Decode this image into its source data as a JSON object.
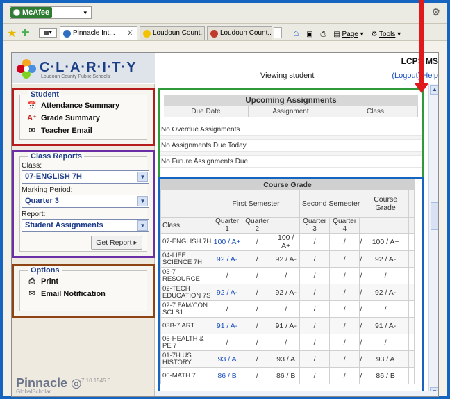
{
  "browser": {
    "toolbar_name": "McAfee",
    "tabs": [
      {
        "label": "Pinnacle Int...",
        "close": "X"
      },
      {
        "label": "Loudoun Count..."
      },
      {
        "label": "Loudoun Count..."
      }
    ],
    "tools": {
      "page": "Page",
      "tools": "Tools"
    }
  },
  "header": {
    "app_name": "C·L·A·R·I·T·Y",
    "subtitle": "Loudoun County Public Schools",
    "school": "LCPS MS",
    "viewing": "Viewing student",
    "logout": "Logout",
    "help": "Help"
  },
  "sidebar": {
    "student": {
      "title": "Student",
      "items": [
        "Attendance Summary",
        "Grade Summary",
        "Teacher Email"
      ]
    },
    "class_reports": {
      "title": "Class Reports",
      "class_label": "Class:",
      "class_value": "07-ENGLISH 7H",
      "period_label": "Marking Period:",
      "period_value": "Quarter 3",
      "report_label": "Report:",
      "report_value": "Student Assignments",
      "button": "Get Report"
    },
    "options": {
      "title": "Options",
      "items": [
        "Print",
        "Email Notification"
      ]
    },
    "footer": {
      "brand": "Pinnacle",
      "brand_sub": "GlobalScholar",
      "version": "v7.10.1545.0"
    }
  },
  "upcoming": {
    "title": "Upcoming Assignments",
    "columns": [
      "Due Date",
      "Assignment",
      "Class"
    ],
    "rows": [
      "No Overdue Assignments",
      "No Assignments Due Today",
      "No Future Assignments Due"
    ]
  },
  "course_grade": {
    "title": "Course Grade",
    "sem1": "First Semester",
    "sem2": "Second Semester",
    "final": "Course Grade",
    "class_header": "Class",
    "q1": "Quarter 1",
    "q2": "Quarter 2",
    "q3": "Quarter 3",
    "q4": "Quarter 4",
    "rows": [
      {
        "cls": "07-ENGLISH 7H",
        "q1": "100 / A+",
        "q2": "/",
        "s1": "100 / A+",
        "q3": "/",
        "q4": "/",
        "s2": "/",
        "fin": "100 / A+"
      },
      {
        "cls": "04-LIFE SCIENCE 7H",
        "q1": "92 / A-",
        "q2": "/",
        "s1": "92 / A-",
        "q3": "/",
        "q4": "/",
        "s2": "/",
        "fin": "92 / A-"
      },
      {
        "cls": "03-7 RESOURCE",
        "q1": "/",
        "q2": "/",
        "s1": "/",
        "q3": "/",
        "q4": "/",
        "s2": "/",
        "fin": "/"
      },
      {
        "cls": "02-TECH EDUCATION 7S",
        "q1": "92 / A-",
        "q2": "/",
        "s1": "92 / A-",
        "q3": "/",
        "q4": "/",
        "s2": "/",
        "fin": "92 / A-"
      },
      {
        "cls": "02-7 FAM/CON SCI S1",
        "q1": "/",
        "q2": "/",
        "s1": "/",
        "q3": "/",
        "q4": "/",
        "s2": "/",
        "fin": "/"
      },
      {
        "cls": "03B-7 ART",
        "q1": "91 / A-",
        "q2": "/",
        "s1": "91 / A-",
        "q3": "/",
        "q4": "/",
        "s2": "/",
        "fin": "91 / A-"
      },
      {
        "cls": "05-HEALTH & PE 7",
        "q1": "/",
        "q2": "/",
        "s1": "/",
        "q3": "/",
        "q4": "/",
        "s2": "/",
        "fin": "/"
      },
      {
        "cls": "01-7H US HISTORY",
        "q1": "93 / A",
        "q2": "/",
        "s1": "93 / A",
        "q3": "/",
        "q4": "/",
        "s2": "/",
        "fin": "93 / A"
      },
      {
        "cls": "06-MATH 7",
        "q1": "86 / B",
        "q2": "/",
        "s1": "86 / B",
        "q3": "/",
        "q4": "/",
        "s2": "/",
        "fin": "86 / B"
      }
    ]
  },
  "colors": {
    "accent": "#1f3d8b",
    "link": "#1a4fbf",
    "annot_red": "#b71c1c",
    "annot_purple": "#6a2fa6",
    "annot_brown": "#8d4313",
    "annot_green": "#2e9a3a",
    "annot_blue": "#1565c0"
  }
}
